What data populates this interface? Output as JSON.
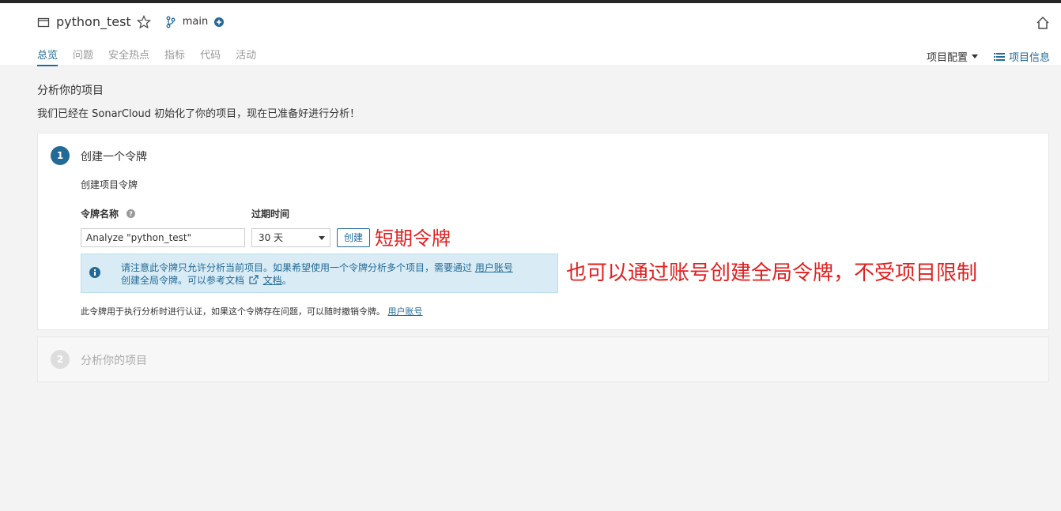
{
  "header": {
    "project_name": "python_test",
    "branch": "main"
  },
  "nav": {
    "tabs": [
      "总览",
      "问题",
      "安全热点",
      "指标",
      "代码",
      "活动"
    ],
    "config_label": "项目配置",
    "info_label": "项目信息"
  },
  "page": {
    "title": "分析你的项目",
    "subtitle": "我们已经在 SonarCloud 初始化了你的项目，现在已准备好进行分析！"
  },
  "step1": {
    "number": "1",
    "title": "创建一个令牌",
    "subtitle": "创建项目令牌",
    "token_name_label": "令牌名称",
    "expiry_label": "过期时间",
    "token_name_value": "Analyze \"python_test\"",
    "expiry_value": "30 天",
    "create_button": "创建",
    "alert_line1": "请注意此令牌只允许分析当前项目。如果希望使用一个令牌分析多个项目，需要通过",
    "alert_link1": "用户账号",
    "alert_line2": "创建全局令牌。可以参考文档",
    "alert_link2": "文档",
    "alert_end": "。",
    "footnote": "此令牌用于执行分析时进行认证，如果这个令牌存在问题，可以随时撤销令牌。",
    "footnote_link": "用户账号"
  },
  "step2": {
    "number": "2",
    "title": "分析你的项目"
  },
  "annotations": {
    "short_token": "短期令牌",
    "global_token": "也可以通过账号创建全局令牌，不受项目限制"
  },
  "colors": {
    "accent": "#236a97",
    "annotation": "#e02020"
  }
}
